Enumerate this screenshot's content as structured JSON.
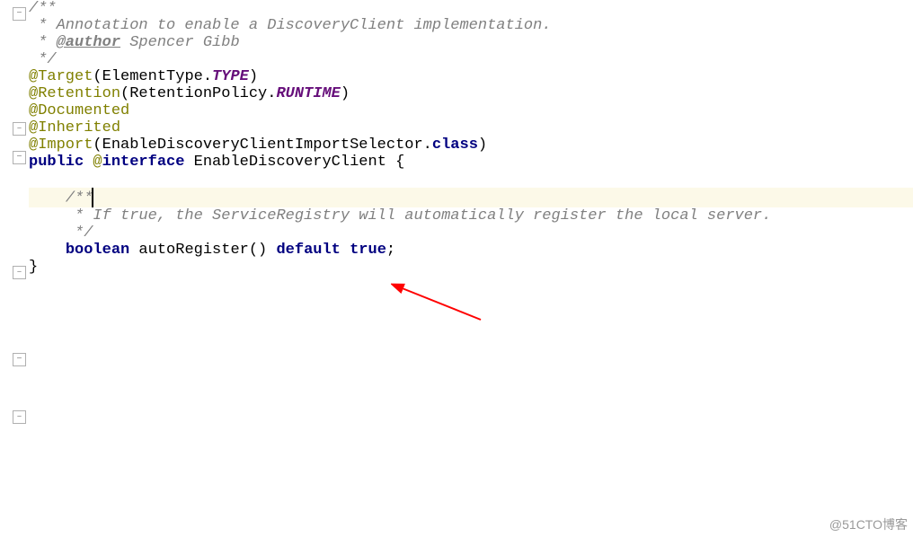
{
  "code": {
    "doc1_open": "/**",
    "doc1_line1": " * Annotation to enable a DiscoveryClient implementation.",
    "doc1_author_tag": "@author",
    "doc1_author_name": " Spencer Gibb",
    "doc1_close": " */",
    "target_anno": "@Target",
    "target_open": "(ElementType.",
    "target_val": "TYPE",
    "target_close": ")",
    "retention_anno": "@Retention",
    "retention_open": "(RetentionPolicy.",
    "retention_val": "RUNTIME",
    "retention_close": ")",
    "documented_anno": "@Documented",
    "inherited_anno": "@Inherited",
    "import_anno": "@Import",
    "import_open": "(EnableDiscoveryClientImportSelector.",
    "import_class": "class",
    "import_close": ")",
    "decl_public": "public ",
    "decl_at": "@",
    "decl_interface": "interface",
    "decl_name": " EnableDiscoveryClient ",
    "decl_brace": "{",
    "doc2_open": "/**",
    "doc2_line1": " * If true, the ServiceRegistry will automatically register the local server.",
    "doc2_close": " */",
    "method_type": "boolean",
    "method_name": " autoRegister",
    "method_parens": "() ",
    "method_default": "default ",
    "method_true": "true",
    "method_semi": ";",
    "close_brace": "}"
  },
  "watermark": "@51CTO博客"
}
